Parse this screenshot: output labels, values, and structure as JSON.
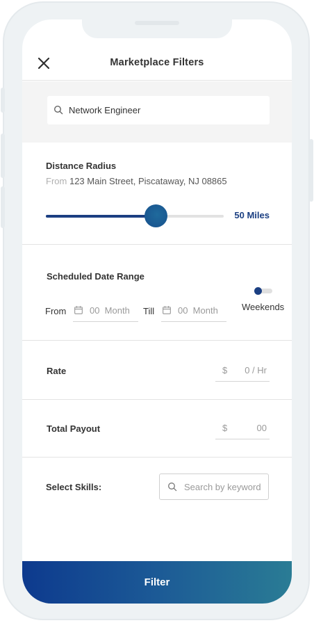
{
  "header": {
    "title": "Marketplace Filters",
    "close_icon": "close-icon"
  },
  "search": {
    "value": "Network Engineer",
    "icon": "search-icon"
  },
  "distance": {
    "label": "Distance Radius",
    "from_prefix": "From",
    "address": "123 Main Street, Piscataway, NJ 08865",
    "slider_fraction": 0.62,
    "value_text": "50 Miles"
  },
  "schedule": {
    "label": "Scheduled Date Range",
    "from_label": "From",
    "from_placeholder": "00  Month",
    "till_label": "Till",
    "till_placeholder": "00  Month",
    "weekends_label": "Weekends",
    "weekends_on": true
  },
  "rate": {
    "label": "Rate",
    "currency": "$",
    "value": "0 / Hr"
  },
  "payout": {
    "label": "Total Payout",
    "currency": "$",
    "value": "00"
  },
  "skills": {
    "label": "Select Skills:",
    "placeholder": "Search by keyword"
  },
  "footer": {
    "button_label": "Filter"
  },
  "colors": {
    "primary": "#1b3f82",
    "gradient_start": "#0d3a8e",
    "gradient_end": "#2a7c95",
    "section_bg": "#f4f4f4"
  }
}
